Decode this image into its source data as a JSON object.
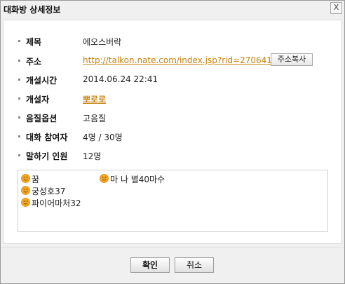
{
  "window": {
    "title": "대화방 상세정보",
    "close_label": "X"
  },
  "details": [
    {
      "label": "제목",
      "value": "에오스버락"
    },
    {
      "label": "주소",
      "value": "http://talkon.nate.com/index.jsp?rid=27064140"
    },
    {
      "label": "개설시간",
      "value": "2014.06.24 22:41"
    },
    {
      "label": "개설자",
      "value": "뽀로로"
    },
    {
      "label": "음질옵션",
      "value": "고음질"
    },
    {
      "label": "대화 참여자",
      "value": "4명 / 30명"
    },
    {
      "label": "말하기 인원",
      "value": "12명"
    }
  ],
  "copy_button": "주소복사",
  "participants": [
    "꿈",
    "마 나 별40마수",
    "궁성호37",
    "파이어마처32"
  ],
  "buttons": {
    "ok": "확인",
    "cancel": "취소"
  },
  "colors": {
    "link": "#c7820f",
    "smiley": "#f5a623"
  },
  "icons": {
    "member": "smiley-face-icon",
    "close": "close-icon"
  }
}
